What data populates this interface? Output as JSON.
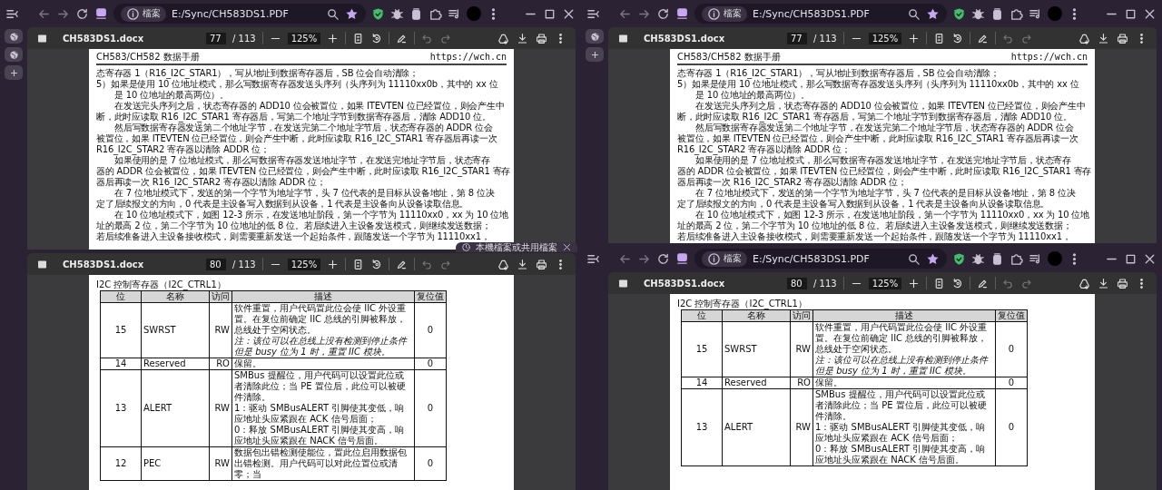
{
  "columns": [
    {
      "windows": [
        {
          "chrome": {
            "site_label": "檔案",
            "url": "E:/Sync/CH583DS1.PDF"
          },
          "rail": [
            {
              "kind": "globe"
            },
            {
              "kind": "globe"
            },
            {
              "kind": "plus"
            }
          ],
          "viewers": [
            {
              "toolbar": {
                "title": "CH583DS1.docx",
                "page": "77",
                "total": "/ 113",
                "zoom": "125%"
              },
              "page": {
                "kind": "text",
                "header_left": "CH583/CH582 数据手册",
                "header_right": "https://wch.cn",
                "lines": [
                  {
                    "text": "态寄存器 1（R16_I2C_STAR1），写从地址到数据寄存器后，SB 位会自动清除；",
                    "kind": "plain"
                  },
                  {
                    "text": "5）如果是使用 10 位地址模式，那么写数据寄存器发送头序列（头序列为 11110xx0b，其中的 xx 位",
                    "kind": "plain"
                  },
                  {
                    "text": "是 10 位地址的最高两位）。",
                    "kind": "indent"
                  },
                  {
                    "text": "在发送完头序列之后，状态寄存器的 ADD10 位会被置位，如果 ITEVTEN 位已经置位，则会产生中",
                    "kind": "indent"
                  },
                  {
                    "text": "断，此时应读取 R16_I2C_STAR1 寄存器后，写第二个地址字节到数据寄存器后，清除 ADD10 位。",
                    "kind": "plain"
                  },
                  {
                    "text": "然后写数据寄存器发送第二个地址字节，在发送完第二个地址字节后，状态寄存器的 ADDR 位会",
                    "kind": "indent"
                  },
                  {
                    "text": "被置位，如果 ITEVTEN 位已经置位，则会产生中断，此时应读取 R16_I2C_STAR1 寄存器后再读一次",
                    "kind": "plain"
                  },
                  {
                    "text": "R16_I2C_STAR2 寄存器以清除 ADDR 位；",
                    "kind": "plain"
                  },
                  {
                    "text": "如果使用的是 7 位地址模式，那么写数据寄存器发送地址字节，在发送完地址字节后，状态寄存",
                    "kind": "indent"
                  },
                  {
                    "text": "器的 ADDR 位会被置位，如果 ITEVTEN 位已经置位，则会产生中断，此时应读取 R16_I2C_STAR1 寄存",
                    "kind": "plain"
                  },
                  {
                    "text": "器后再读一次 R16_I2C_STAR2 寄存器以清除 ADDR 位；",
                    "kind": "plain"
                  },
                  {
                    "text": "在 7 位地址模式下，发送的第一个字节为地址字节，头 7 位代表的是目标从设备地址，第 8 位决",
                    "kind": "indent"
                  },
                  {
                    "text": "定了后续报文的方向，0 代表是主设备写入数据到从设备，1 代表是主设备向从设备读取信息。",
                    "kind": "plain"
                  },
                  {
                    "text": "在 10 位地址模式下，如图 12-3 所示，在发送地址阶段，第一个字节为 11110xx0，xx 为 10 位地",
                    "kind": "indent"
                  },
                  {
                    "text": "址的最高 2 位，第二个字节为 10 位地址的低 8 位。若后续进入主设备发送模式，则继续发送数据；",
                    "kind": "plain"
                  },
                  {
                    "text": "若后续准备进入主设备接收模式，则需要重新发送一个起始条件，跟随发送一个字节为 11110xx1，",
                    "kind": "plain"
                  }
                ]
              }
            },
            {
              "toolbar": {
                "title": "CH583DS1.docx",
                "page": "80",
                "total": "/ 113",
                "zoom": "125%"
              },
              "page": {
                "kind": "table",
                "title": "I2C 控制寄存器（I2C_CTRL1）",
                "columns": [
                  "位",
                  "名称",
                  "访问",
                  "描述",
                  "复位值"
                ],
                "rows": [
                  {
                    "bit": "15",
                    "name": "SWRST",
                    "access": "RW",
                    "description": [
                      {
                        "text": "软件重置，用户代码置此位会使 IIC 外设重置。在复位前确定 IIC 总线的引脚被释放，总线处于空闲状态。",
                        "italic": false
                      },
                      {
                        "text": "注：该位可以在总线上没有检测到停止条件但是 busy 位为 1 时，重置 IIC 模块。",
                        "italic": true
                      }
                    ],
                    "reset": "0"
                  },
                  {
                    "bit": "14",
                    "name": "Reserved",
                    "access": "RO",
                    "description": [
                      {
                        "text": "保留。",
                        "italic": false
                      }
                    ],
                    "reset": "0"
                  },
                  {
                    "bit": "13",
                    "name": "ALERT",
                    "access": "RW",
                    "description": [
                      {
                        "text": "SMBus 提醒位，用户代码可以设置此位或者清除此位；当 PE 置位后，此位可以被硬件清除。",
                        "italic": false
                      },
                      {
                        "text": "1：驱动 SMBusALERT 引脚使其变低，响应地址头应紧跟在 ACK 信号后面；",
                        "italic": false
                      },
                      {
                        "text": "0：释放 SMBusALERT 引脚使其变高，响应地址头应紧跟在 NACK 信号后面。",
                        "italic": false
                      }
                    ],
                    "reset": "0"
                  },
                  {
                    "bit": "12",
                    "name": "PEC",
                    "access": "RW",
                    "description": [
                      {
                        "text": "数据包出错检测使能位，置此位启用数据包出错检测。用户代码可以对此位置位或清零；当",
                        "italic": false
                      }
                    ],
                    "reset": "0"
                  }
                ]
              }
            }
          ],
          "toast": {
            "text": "本機檔案或共用檔案"
          }
        }
      ]
    },
    {
      "windows": [
        {
          "chrome": {
            "site_label": "檔案",
            "url": "E:/Sync/CH583DS1.PDF"
          },
          "rail": [
            {
              "kind": "globe"
            },
            {
              "kind": "plus"
            }
          ],
          "viewers": [
            {
              "toolbar": {
                "title": "CH583DS1.docx",
                "page": "77",
                "total": "/ 113",
                "zoom": "125%"
              },
              "page": {
                "kind": "text",
                "header_left": "CH583/CH582 数据手册",
                "header_right": "https://wch.cn",
                "lines": [
                  {
                    "text": "态寄存器 1（R16_I2C_STAR1），写从地址到数据寄存器后，SB 位会自动清除；",
                    "kind": "plain"
                  },
                  {
                    "text": "5）如果是使用 10 位地址模式，那么写数据寄存器发送头序列（头序列为 11110xx0b，其中的 xx 位",
                    "kind": "plain"
                  },
                  {
                    "text": "是 10 位地址的最高两位）。",
                    "kind": "indent"
                  },
                  {
                    "text": "在发送完头序列之后，状态寄存器的 ADD10 位会被置位，如果 ITEVTEN 位已经置位，则会产生中",
                    "kind": "indent"
                  },
                  {
                    "text": "断，此时应读取 R16_I2C_STAR1 寄存器后，写第二个地址字节到数据寄存器后，清除 ADD10 位。",
                    "kind": "plain"
                  },
                  {
                    "text": "然后写数据寄存器发送第二个地址字节，在发送完第二个地址字节后，状态寄存器的 ADDR 位会",
                    "kind": "indent"
                  },
                  {
                    "text": "被置位，如果 ITEVTEN 位已经置位，则会产生中断，此时应读取 R16_I2C_STAR1 寄存器后再读一次",
                    "kind": "plain"
                  },
                  {
                    "text": "R16_I2C_STAR2 寄存器以清除 ADDR 位；",
                    "kind": "plain"
                  },
                  {
                    "text": "如果使用的是 7 位地址模式，那么写数据寄存器发送地址字节，在发送完地址字节后，状态寄存",
                    "kind": "indent"
                  },
                  {
                    "text": "器的 ADDR 位会被置位，如果 ITEVTEN 位已经置位，则会产生中断，此时应读取 R16_I2C_STAR1 寄存",
                    "kind": "plain"
                  },
                  {
                    "text": "器后再读一次 R16_I2C_STAR2 寄存器以清除 ADDR 位；",
                    "kind": "plain"
                  },
                  {
                    "text": "在 7 位地址模式下，发送的第一个字节为地址字节，头 7 位代表的是目标从设备地址，第 8 位决",
                    "kind": "indent"
                  },
                  {
                    "text": "定了后续报文的方向，0 代表是主设备写入数据到从设备，1 代表是主设备向从设备读取信息。",
                    "kind": "plain"
                  },
                  {
                    "text": "在 10 位地址模式下，如图 12-3 所示，在发送地址阶段，第一个字节为 11110xx0，xx 为 10 位地",
                    "kind": "indent"
                  },
                  {
                    "text": "址的最高 2 位，第二个字节为 10 位地址的低 8 位。若后续进入主设备发送模式，则继续发送数据；",
                    "kind": "plain"
                  },
                  {
                    "text": "若后续准备进入主设备接收模式，则需要重新发送一个起始条件，跟随发送一个字节为 11110xx1，",
                    "kind": "plain"
                  }
                ]
              }
            }
          ]
        },
        {
          "chrome": {
            "site_label": "檔案",
            "url": "E:/Sync/CH583DS1.PDF"
          },
          "viewers": [
            {
              "toolbar": {
                "title": "CH583DS1.docx",
                "page": "80",
                "total": "/ 113",
                "zoom": "125%"
              },
              "page": {
                "kind": "table",
                "title": "I2C 控制寄存器（I2C_CTRL1）",
                "columns": [
                  "位",
                  "名称",
                  "访问",
                  "描述",
                  "复位值"
                ],
                "rows": [
                  {
                    "bit": "15",
                    "name": "SWRST",
                    "access": "RW",
                    "description": [
                      {
                        "text": "软件重置，用户代码置此位会使 IIC 外设重置。在复位前确定 IIC 总线的引脚被释放，总线处于空闲状态。",
                        "italic": false
                      },
                      {
                        "text": "注：该位可以在总线上没有检测到停止条件但是 busy 位为 1 时，重置 IIC 模块。",
                        "italic": true
                      }
                    ],
                    "reset": "0"
                  },
                  {
                    "bit": "14",
                    "name": "Reserved",
                    "access": "RO",
                    "description": [
                      {
                        "text": "保留。",
                        "italic": false
                      }
                    ],
                    "reset": "0"
                  },
                  {
                    "bit": "13",
                    "name": "ALERT",
                    "access": "RW",
                    "description": [
                      {
                        "text": "SMBus 提醒位，用户代码可以设置此位或者清除此位；当 PE 置位后，此位可以被硬件清除。",
                        "italic": false
                      },
                      {
                        "text": "1：驱动 SMBusALERT 引脚使其变低，响应地址头应紧跟在 ACK 信号后面；",
                        "italic": false
                      },
                      {
                        "text": "0：释放 SMBusALERT 引脚使其变高，响应地址头应紧跟在 NACK 信号后面。",
                        "italic": false
                      }
                    ],
                    "reset": "0"
                  }
                ]
              }
            }
          ]
        }
      ]
    }
  ]
}
